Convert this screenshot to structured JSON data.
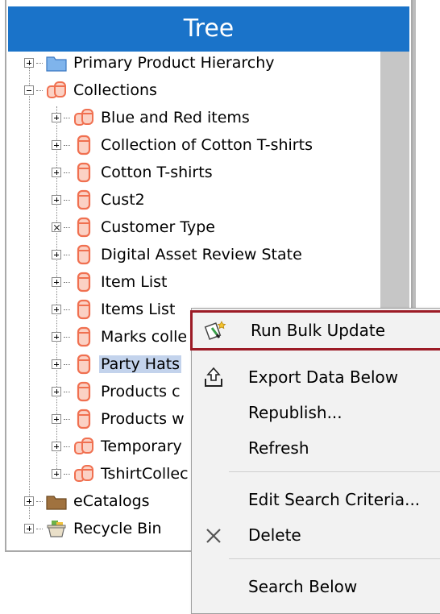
{
  "tree": {
    "title": "Tree",
    "items": [
      {
        "label": "Primary Product Hierarchy",
        "expander": "plus",
        "icon": "folder-blue-icon"
      },
      {
        "label": "Collections",
        "expander": "minus",
        "icon": "collection-stack-icon"
      },
      {
        "label": "Blue and Red items",
        "expander": "plus",
        "icon": "collection-stack-icon"
      },
      {
        "label": "Collection of Cotton T-shirts",
        "expander": "plus",
        "icon": "collection-icon"
      },
      {
        "label": "Cotton T-shirts",
        "expander": "plus",
        "icon": "collection-icon"
      },
      {
        "label": "Cust2",
        "expander": "plus",
        "icon": "collection-icon"
      },
      {
        "label": "Customer Type",
        "expander": "x",
        "icon": "collection-icon"
      },
      {
        "label": "Digital Asset Review State",
        "expander": "plus",
        "icon": "collection-icon"
      },
      {
        "label": "Item List",
        "expander": "plus",
        "icon": "collection-icon"
      },
      {
        "label": "Items List",
        "expander": "plus",
        "icon": "collection-icon"
      },
      {
        "label": "Marks colle",
        "expander": "plus",
        "icon": "collection-icon"
      },
      {
        "label": "Party Hats",
        "expander": "plus",
        "icon": "collection-icon",
        "selected": true
      },
      {
        "label": "Products c",
        "expander": "plus",
        "icon": "collection-icon"
      },
      {
        "label": "Products w",
        "expander": "plus",
        "icon": "collection-icon"
      },
      {
        "label": "Temporary",
        "expander": "plus",
        "icon": "collection-stack-icon"
      },
      {
        "label": "TshirtCollec",
        "expander": "plus",
        "icon": "collection-stack-icon"
      },
      {
        "label": "eCatalogs",
        "expander": "plus",
        "icon": "folder-brown-icon"
      },
      {
        "label": "Recycle Bin",
        "expander": "plus",
        "icon": "recycle-bin-icon"
      }
    ]
  },
  "context_menu": {
    "items": [
      {
        "label": "Run Bulk Update",
        "icon": "bulk-update-icon",
        "highlighted": true
      },
      {
        "label": "Export Data Below",
        "icon": "export-icon"
      },
      {
        "label": "Republish..."
      },
      {
        "label": "Refresh"
      },
      {
        "label": "Edit Search Criteria..."
      },
      {
        "label": "Delete",
        "icon": "delete-x-icon"
      },
      {
        "label": "Search Below"
      }
    ]
  },
  "colors": {
    "header": "#1a73c9",
    "highlight_border": "#9c1b26",
    "selection": "#c3d3ec",
    "collection": "#f07050"
  }
}
